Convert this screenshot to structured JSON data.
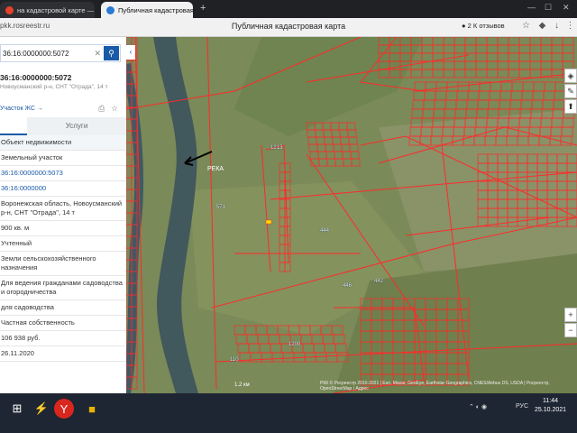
{
  "browser": {
    "tabs": [
      {
        "label": "на кадастровой карте —",
        "favicon_color": "#e5412d"
      },
      {
        "label": "Публичная кадастровая",
        "favicon_color": "#2b7ad4"
      }
    ],
    "new_tab": "+",
    "window_controls": [
      "—",
      "☐",
      "✕"
    ],
    "url": "pkk.rosreestr.ru",
    "page_title": "Публичная кадастровая карта",
    "reviews_label": "2 К отзывов"
  },
  "panel": {
    "search_value": "36:16:0000000:5072",
    "object_number": "36:16:0000000:5072",
    "object_sub": "Новоусманский р-н, СНТ \"Отрада\", 14 т",
    "zhs_link": "Участок ЖС →",
    "tabs": {
      "info": "",
      "services": "Услуги"
    },
    "rows": [
      {
        "text": "Объект недвижимости",
        "style": "shade"
      },
      {
        "text": "Земельный участок",
        "style": ""
      },
      {
        "text": "36:16:0000000:5073",
        "style": "link"
      },
      {
        "text": "36:16:0000000",
        "style": "link"
      },
      {
        "text": "Воронежская область, Новоусманский р-н, СНТ \"Отрада\", 14 т",
        "style": ""
      },
      {
        "text": "900 кв. м",
        "style": ""
      },
      {
        "text": "Учтенный",
        "style": ""
      },
      {
        "text": "Земли сельскохозяйственного назначения",
        "style": ""
      },
      {
        "text": "Для ведения гражданами садоводства и огородничества",
        "style": ""
      },
      {
        "text": "для садоводства",
        "style": ""
      },
      {
        "text": "Частная собственность",
        "style": ""
      },
      {
        "text": "106 938 руб.",
        "style": ""
      },
      {
        "text": "26.11.2020",
        "style": ""
      }
    ]
  },
  "map": {
    "river_label": "РЕКА",
    "parcel_labels": [
      "444",
      "442",
      "446",
      "571",
      "1213",
      "1200",
      "110"
    ],
    "scale": "1.2 км",
    "copyright": "РКК © Росреестр 2010-2021 | Esri, Maxar, GeoEye, Earthstar Geographics, CNES/Airbus DS, USDA | Росреестр, OpenStreetMap | Адрес",
    "controls": [
      "◈",
      "✎",
      "⬆"
    ],
    "zoom": [
      "+",
      "−"
    ],
    "colors": {
      "parcel_border": "#ff2a2a",
      "terrain": "#7d8d5c",
      "river": "#3f5a63"
    }
  },
  "taskbar": {
    "lang": "РУС",
    "time": "11:44",
    "date": "25.10.2021"
  }
}
